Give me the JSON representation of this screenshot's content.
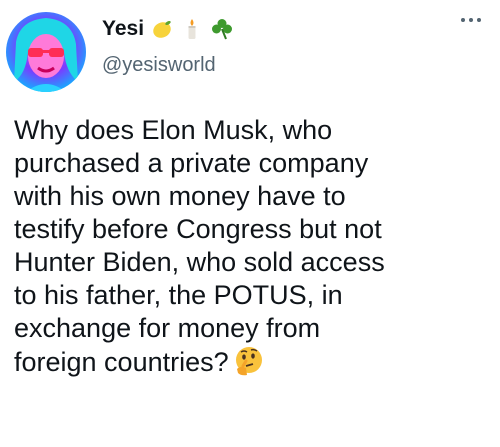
{
  "tweet": {
    "display_name": "Yesi",
    "name_emojis": [
      "lemon-icon",
      "candle-icon",
      "shamrock-icon"
    ],
    "handle": "@yesisworld",
    "text": "Why does Elon Musk, who\npurchased a private company\nwith his own money have to\ntestify before Congress but not\nHunter Biden, who sold access\nto his father, the POTUS, in\nexchange for money from\nforeign countries?",
    "trailing_emoji": "thinking-face-icon"
  },
  "colors": {
    "text_primary": "#0f1419",
    "text_secondary": "#536471",
    "background": "#ffffff"
  }
}
